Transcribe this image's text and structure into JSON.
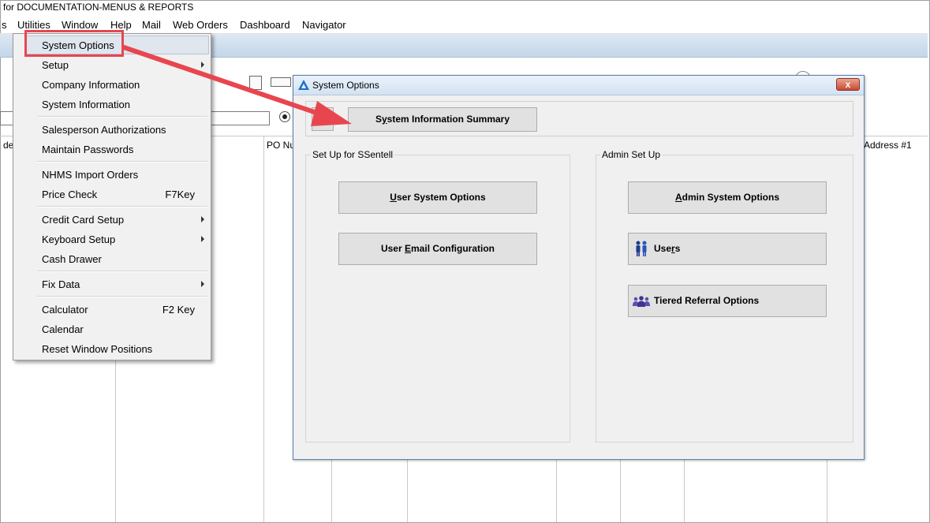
{
  "window": {
    "title": "for DOCUMENTATION-MENUS & REPORTS"
  },
  "menubar": {
    "items": [
      "s",
      "Utilities",
      "Window",
      "Help",
      "Mail",
      "Web Orders",
      "Dashboard",
      "Navigator"
    ]
  },
  "background": {
    "column_headers": [
      "de",
      "PO Nu",
      "Address #1"
    ]
  },
  "utilities_menu": {
    "items": [
      {
        "label": "System Options"
      },
      {
        "label": "Setup",
        "submenu": true
      },
      {
        "label": "Company Information"
      },
      {
        "label": "System Information"
      },
      {
        "label": "Salesperson Authorizations"
      },
      {
        "label": "Maintain Passwords"
      },
      {
        "label": "NHMS Import Orders"
      },
      {
        "label": "Price Check",
        "accelerator": "F7Key"
      },
      {
        "label": "Credit Card Setup",
        "submenu": true
      },
      {
        "label": "Keyboard Setup",
        "submenu": true
      },
      {
        "label": "Cash Drawer"
      },
      {
        "label": "Fix Data",
        "submenu": true
      },
      {
        "label": "Calculator",
        "accelerator": "F2 Key"
      },
      {
        "label": "Calendar"
      },
      {
        "label": "Reset Window Positions"
      }
    ]
  },
  "dialog": {
    "title": "System Options",
    "close_label": "x",
    "summary_button": {
      "pre": "S",
      "mn": "y",
      "post": "stem Information Summary"
    },
    "left_group": {
      "label": "Set Up for SSentell",
      "buttons": [
        {
          "pre": "",
          "mn": "U",
          "post": "ser System Options"
        },
        {
          "pre": "User ",
          "mn": "E",
          "post": "mail Configuration"
        }
      ]
    },
    "right_group": {
      "label": "Admin Set Up",
      "buttons": [
        {
          "pre": "",
          "mn": "A",
          "post": "dmin System Options"
        },
        {
          "pre": "Use",
          "mn": "r",
          "post": "s"
        },
        {
          "pre": "Tiered Referral Options",
          "mn": "",
          "post": ""
        }
      ]
    }
  },
  "colors": {
    "highlight": "#e8464e",
    "accent": "#1e6fc9",
    "people_icon": "#5a4fb3"
  }
}
